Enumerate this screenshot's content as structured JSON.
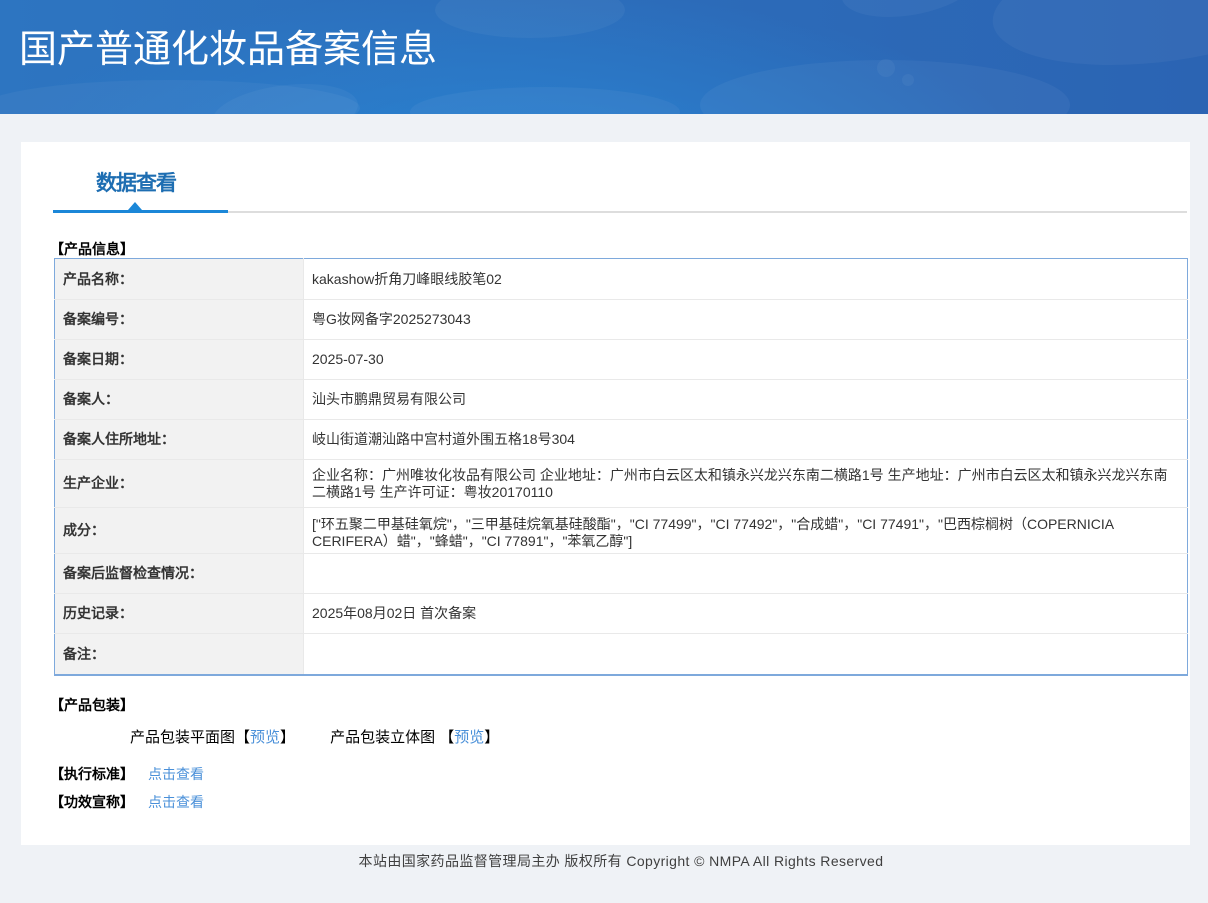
{
  "header": {
    "title": "国产普通化妆品备案信息"
  },
  "tabs": {
    "active": "数据查看"
  },
  "product_info": {
    "section_title": "【产品信息】",
    "rows": [
      {
        "label": "产品名称：",
        "value": "kakashow折角刀峰眼线胶笔02"
      },
      {
        "label": "备案编号：",
        "value": "粤G妆网备字2025273043"
      },
      {
        "label": "备案日期：",
        "value": "2025-07-30"
      },
      {
        "label": "备案人：",
        "value": "汕头市鹏鼎贸易有限公司"
      },
      {
        "label": "备案人住所地址：",
        "value": "岐山街道潮汕路中宫村道外围五格18号304"
      },
      {
        "label": "生产企业：",
        "value": "企业名称：广州唯妆化妆品有限公司 企业地址：广州市白云区太和镇永兴龙兴东南二横路1号 生产地址：广州市白云区太和镇永兴龙兴东南二横路1号 生产许可证：粤妆20170110"
      },
      {
        "label": "成分：",
        "value": "[\"环五聚二甲基硅氧烷\"，\"三甲基硅烷氧基硅酸酯\"，\"CI 77499\"，\"CI 77492\"，\"合成蜡\"，\"CI 77491\"，\"巴西棕榈树（COPERNICIA CERIFERA）蜡\"，\"蜂蜡\"，\"CI 77891\"，\"苯氧乙醇\"]"
      },
      {
        "label": "备案后监督检查情况：",
        "value": ""
      },
      {
        "label": "历史记录：",
        "value": "2025年08月02日 首次备案"
      },
      {
        "label": "备注：",
        "value": ""
      }
    ]
  },
  "packaging": {
    "section_title": "【产品包装】",
    "items": [
      {
        "label": "产品包装平面图",
        "bracket_open": "【",
        "link": "预览",
        "bracket_close": "】"
      },
      {
        "label": "产品包装立体图",
        "bracket_open": "【",
        "link": "预览",
        "bracket_close": "】"
      }
    ]
  },
  "standard": {
    "label": "【执行标准】",
    "link": "点击查看"
  },
  "efficacy": {
    "label": "【功效宣称】",
    "link": "点击查看"
  },
  "footer": {
    "text": "本站由国家药品监督管理局主办 版权所有 Copyright © NMPA All Rights Reserved"
  },
  "colors": {
    "header_blue_left": "#2d75c1",
    "header_blue_right": "#2b64b3",
    "tab_text": "#1e6eb2",
    "tab_underline": "#1b87d8",
    "link_blue": "#4a90d9",
    "label_bg": "#f2f2f2",
    "table_border": "#afc8e1"
  }
}
